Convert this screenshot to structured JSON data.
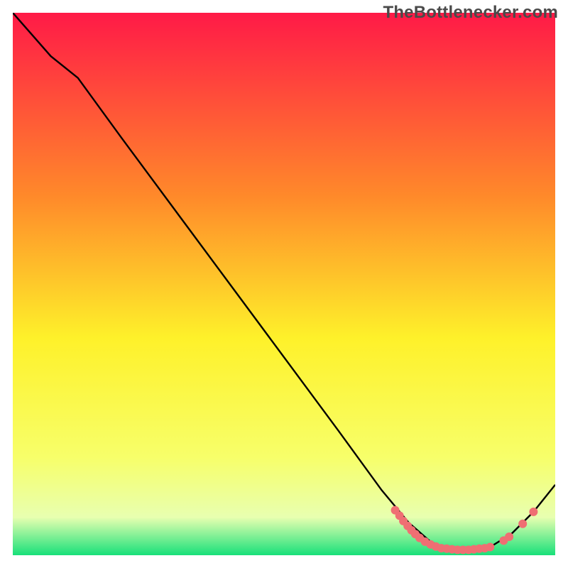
{
  "watermark": "TheBottlenecker.com",
  "colors": {
    "curve": "#000000",
    "marker": "#ef6f73",
    "gradient_top": "#ff1a47",
    "gradient_mid_upper": "#ff8a2a",
    "gradient_mid": "#fef12a",
    "gradient_mid_lower": "#f7ff6a",
    "gradient_low": "#e8ffb0",
    "gradient_bottom": "#18e07a"
  },
  "chart_data": {
    "type": "line",
    "title": "",
    "xlabel": "",
    "ylabel": "",
    "xlim": [
      0,
      100
    ],
    "ylim": [
      0,
      100
    ],
    "grid": false,
    "legend": false,
    "curve": [
      {
        "x": 0,
        "y": 100
      },
      {
        "x": 7,
        "y": 92
      },
      {
        "x": 12,
        "y": 88
      },
      {
        "x": 20,
        "y": 77
      },
      {
        "x": 30,
        "y": 63.5
      },
      {
        "x": 40,
        "y": 50
      },
      {
        "x": 50,
        "y": 36.5
      },
      {
        "x": 60,
        "y": 23
      },
      {
        "x": 68,
        "y": 12
      },
      {
        "x": 73,
        "y": 6
      },
      {
        "x": 77,
        "y": 2.5
      },
      {
        "x": 80,
        "y": 1.2
      },
      {
        "x": 84,
        "y": 1.0
      },
      {
        "x": 88,
        "y": 1.5
      },
      {
        "x": 92,
        "y": 4
      },
      {
        "x": 96,
        "y": 8
      },
      {
        "x": 100,
        "y": 13
      }
    ],
    "markers": [
      {
        "x": 70.5,
        "y": 8.3
      },
      {
        "x": 71.3,
        "y": 7.3
      },
      {
        "x": 72.0,
        "y": 6.3
      },
      {
        "x": 72.8,
        "y": 5.4
      },
      {
        "x": 73.5,
        "y": 4.6
      },
      {
        "x": 74.2,
        "y": 3.9
      },
      {
        "x": 75.0,
        "y": 3.2
      },
      {
        "x": 76.0,
        "y": 2.5
      },
      {
        "x": 77.0,
        "y": 2.0
      },
      {
        "x": 78.0,
        "y": 1.6
      },
      {
        "x": 79.0,
        "y": 1.3
      },
      {
        "x": 80.0,
        "y": 1.2
      },
      {
        "x": 81.0,
        "y": 1.1
      },
      {
        "x": 82.0,
        "y": 1.0
      },
      {
        "x": 83.0,
        "y": 1.0
      },
      {
        "x": 84.0,
        "y": 1.0
      },
      {
        "x": 85.0,
        "y": 1.1
      },
      {
        "x": 86.0,
        "y": 1.2
      },
      {
        "x": 87.0,
        "y": 1.3
      },
      {
        "x": 88.0,
        "y": 1.5
      },
      {
        "x": 90.5,
        "y": 2.7
      },
      {
        "x": 91.5,
        "y": 3.4
      },
      {
        "x": 94.0,
        "y": 5.8
      },
      {
        "x": 96.0,
        "y": 8.0
      }
    ]
  }
}
